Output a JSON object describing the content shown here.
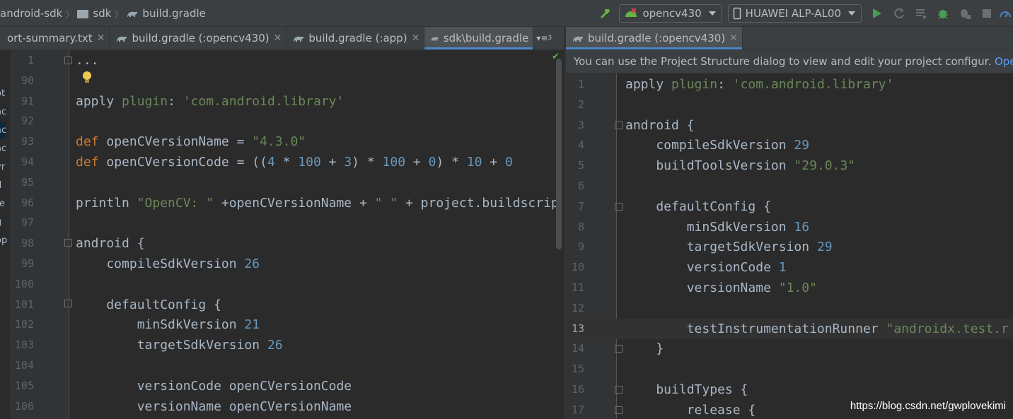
{
  "toolbar": {
    "breadcrumbs": [
      "android-sdk",
      "sdk",
      "build.gradle"
    ],
    "run_config": "opencv430",
    "device": "HUAWEI ALP-AL00"
  },
  "tabs_left": [
    {
      "label": "ort-summary.txt",
      "active": false
    },
    {
      "label": "build.gradle (:opencv430)",
      "active": false
    },
    {
      "label": "build.gradle (:app)",
      "active": false
    },
    {
      "label": "sdk\\build.gradle",
      "active": true
    }
  ],
  "tabs_left_more": "3",
  "tabs_right": [
    {
      "label": "build.gradle (:opencv430)",
      "active": true
    }
  ],
  "side_strip": [
    "ot",
    "ac",
    "ac",
    "ac",
    "vr",
    "d",
    "re",
    "g",
    "op"
  ],
  "left_editor": {
    "fold_text": "...",
    "lines": [
      {
        "num": "1",
        "tokens": [
          {
            "t": "...",
            "c": ""
          }
        ]
      },
      {
        "num": "90",
        "tokens": []
      },
      {
        "num": "91",
        "tokens": [
          {
            "t": "apply ",
            "c": ""
          },
          {
            "t": "plugin",
            "c": "plg"
          },
          {
            "t": ": ",
            "c": ""
          },
          {
            "t": "'com.android.library'",
            "c": "str"
          }
        ]
      },
      {
        "num": "92",
        "tokens": []
      },
      {
        "num": "93",
        "tokens": [
          {
            "t": "def ",
            "c": "kw"
          },
          {
            "t": "openCVersionName = ",
            "c": ""
          },
          {
            "t": "\"4.3.0\"",
            "c": "str"
          }
        ]
      },
      {
        "num": "94",
        "tokens": [
          {
            "t": "def ",
            "c": "kw"
          },
          {
            "t": "openCVersionCode = ((",
            "c": ""
          },
          {
            "t": "4",
            "c": "num"
          },
          {
            "t": " * ",
            "c": ""
          },
          {
            "t": "100",
            "c": "num"
          },
          {
            "t": " + ",
            "c": ""
          },
          {
            "t": "3",
            "c": "num"
          },
          {
            "t": ") * ",
            "c": ""
          },
          {
            "t": "100",
            "c": "num"
          },
          {
            "t": " + ",
            "c": ""
          },
          {
            "t": "0",
            "c": "num"
          },
          {
            "t": ") * ",
            "c": ""
          },
          {
            "t": "10",
            "c": "num"
          },
          {
            "t": " + ",
            "c": ""
          },
          {
            "t": "0",
            "c": "num"
          }
        ]
      },
      {
        "num": "95",
        "tokens": []
      },
      {
        "num": "96",
        "tokens": [
          {
            "t": "println ",
            "c": ""
          },
          {
            "t": "\"OpenCV: \"",
            "c": "str"
          },
          {
            "t": " +openCVersionName + ",
            "c": ""
          },
          {
            "t": "\" \"",
            "c": "str"
          },
          {
            "t": " + project.buildscrip",
            "c": ""
          }
        ]
      },
      {
        "num": "97",
        "tokens": []
      },
      {
        "num": "98",
        "tokens": [
          {
            "t": "android {",
            "c": ""
          }
        ]
      },
      {
        "num": "99",
        "tokens": [
          {
            "t": "    compileSdkVersion ",
            "c": ""
          },
          {
            "t": "26",
            "c": "num"
          }
        ]
      },
      {
        "num": "100",
        "tokens": []
      },
      {
        "num": "101",
        "tokens": [
          {
            "t": "    defaultConfig {",
            "c": ""
          }
        ]
      },
      {
        "num": "102",
        "tokens": [
          {
            "t": "        minSdkVersion ",
            "c": ""
          },
          {
            "t": "21",
            "c": "num"
          }
        ]
      },
      {
        "num": "103",
        "tokens": [
          {
            "t": "        targetSdkVersion ",
            "c": ""
          },
          {
            "t": "26",
            "c": "num"
          }
        ]
      },
      {
        "num": "104",
        "tokens": []
      },
      {
        "num": "105",
        "tokens": [
          {
            "t": "        versionCode openCVersionCode",
            "c": ""
          }
        ]
      },
      {
        "num": "106",
        "tokens": [
          {
            "t": "        versionName openCVersionName",
            "c": ""
          }
        ]
      }
    ]
  },
  "right_editor": {
    "notification": "You can use the Project Structure dialog to view and edit your project configur.",
    "notification_link": "Open",
    "lines": [
      {
        "num": "1",
        "tokens": [
          {
            "t": "apply ",
            "c": ""
          },
          {
            "t": "plugin",
            "c": "plg"
          },
          {
            "t": ": ",
            "c": ""
          },
          {
            "t": "'com.android.library'",
            "c": "str"
          }
        ]
      },
      {
        "num": "2",
        "tokens": []
      },
      {
        "num": "3",
        "tokens": [
          {
            "t": "android {",
            "c": ""
          }
        ]
      },
      {
        "num": "4",
        "tokens": [
          {
            "t": "    compileSdkVersion ",
            "c": ""
          },
          {
            "t": "29",
            "c": "num"
          }
        ]
      },
      {
        "num": "5",
        "tokens": [
          {
            "t": "    buildToolsVersion ",
            "c": ""
          },
          {
            "t": "\"29.0.3\"",
            "c": "str"
          }
        ]
      },
      {
        "num": "6",
        "tokens": []
      },
      {
        "num": "7",
        "tokens": [
          {
            "t": "    defaultConfig {",
            "c": ""
          }
        ]
      },
      {
        "num": "8",
        "tokens": [
          {
            "t": "        minSdkVersion ",
            "c": ""
          },
          {
            "t": "16",
            "c": "num"
          }
        ]
      },
      {
        "num": "9",
        "tokens": [
          {
            "t": "        targetSdkVersion ",
            "c": ""
          },
          {
            "t": "29",
            "c": "num"
          }
        ]
      },
      {
        "num": "10",
        "tokens": [
          {
            "t": "        versionCode ",
            "c": ""
          },
          {
            "t": "1",
            "c": "num"
          }
        ]
      },
      {
        "num": "11",
        "tokens": [
          {
            "t": "        versionName ",
            "c": ""
          },
          {
            "t": "\"1.0\"",
            "c": "str"
          }
        ]
      },
      {
        "num": "12",
        "tokens": []
      },
      {
        "num": "13",
        "tokens": [
          {
            "t": "        testInstrumentationRunner ",
            "c": ""
          },
          {
            "t": "\"androidx.test.r",
            "c": "str"
          }
        ],
        "current": true
      },
      {
        "num": "14",
        "tokens": [
          {
            "t": "    }",
            "c": ""
          }
        ]
      },
      {
        "num": "15",
        "tokens": []
      },
      {
        "num": "16",
        "tokens": [
          {
            "t": "    buildTypes {",
            "c": ""
          }
        ]
      },
      {
        "num": "17",
        "tokens": [
          {
            "t": "        release {",
            "c": ""
          }
        ]
      }
    ]
  },
  "watermark": "https://blog.csdn.net/gwplovekimi",
  "colors": {
    "accent": "#4a88c7",
    "keyword": "#cc7832",
    "string": "#6a8759",
    "number": "#6897bb",
    "text": "#a9b7c6"
  }
}
